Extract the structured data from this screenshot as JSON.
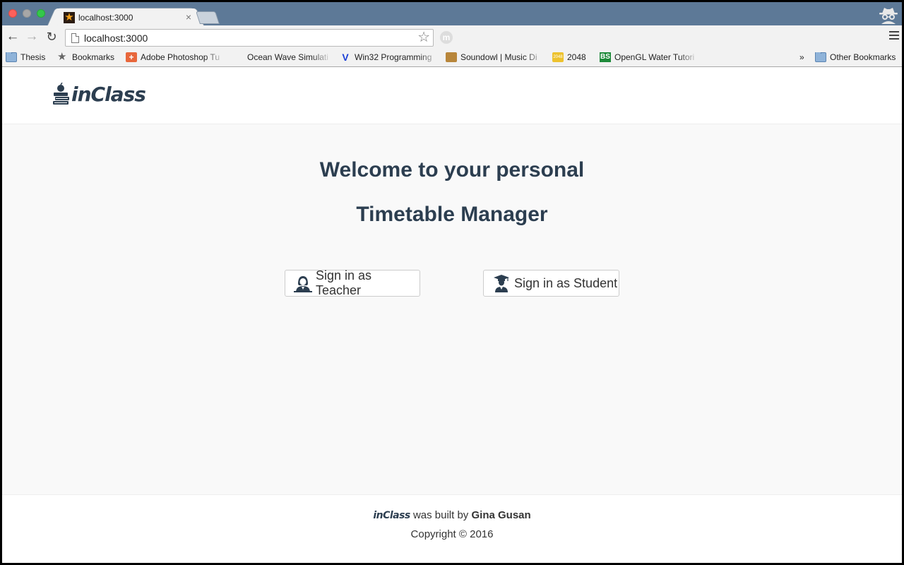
{
  "browser": {
    "tab": {
      "title": "localhost:3000",
      "close_glyph": "×"
    },
    "address": {
      "url": "localhost:3000"
    },
    "bookmarks": [
      {
        "label": "Thesis",
        "icon": "folder-icon"
      },
      {
        "label": "Bookmarks",
        "icon": "star-icon"
      },
      {
        "label": "Adobe Photoshop Tu",
        "icon": "photoshop-icon"
      },
      {
        "label": "Ocean Wave Simulati",
        "icon": "blank-icon"
      },
      {
        "label": "Win32 Programming",
        "icon": "v-icon"
      },
      {
        "label": "Soundowl | Music Di",
        "icon": "owl-icon"
      },
      {
        "label": "2048",
        "icon": "2048-icon"
      },
      {
        "label": "OpenGL Water Tutori",
        "icon": "bs-icon"
      }
    ],
    "overflow_chevron": "»",
    "other_bookmarks": "Other Bookmarks"
  },
  "site": {
    "logo_text": "inClass",
    "hero": {
      "line1": "Welcome to your personal",
      "line2": "Timetable Manager"
    },
    "buttons": {
      "teacher": "Sign in as Teacher",
      "student": "Sign in as Student"
    },
    "footer": {
      "brand": "inClass",
      "built_by": "was built by",
      "author": "Gina Gusan",
      "copyright": "Copyright © 2016"
    }
  },
  "colors": {
    "tabstrip": "#5d7997",
    "heading": "#2c3e50",
    "page_bg": "#f9f9f9"
  }
}
